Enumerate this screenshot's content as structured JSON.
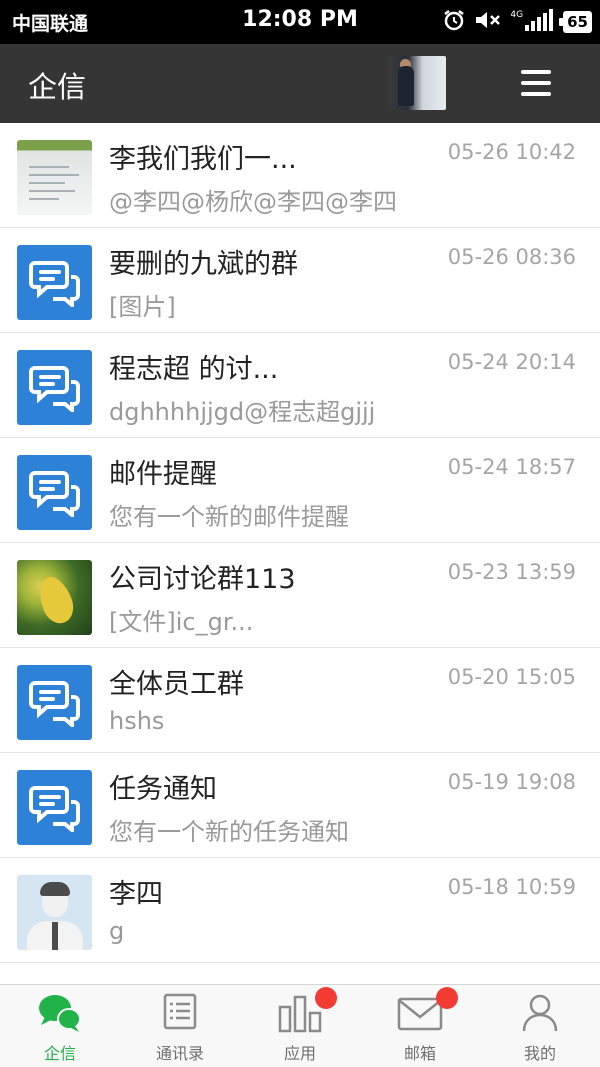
{
  "status_bar": {
    "carrier": "中国联通",
    "time": "12:08 PM",
    "network": "4G",
    "battery": "65"
  },
  "app_bar": {
    "title": "企信"
  },
  "chats": [
    {
      "title": "李我们我们一...",
      "preview": "@李四@杨欣@李四@李四",
      "time": "05-26 10:42",
      "avatar": "document-photo"
    },
    {
      "title": "要删的九斌的群",
      "preview": "[图片]",
      "time": "05-26 08:36",
      "avatar": "group-chat-icon"
    },
    {
      "title": "程志超 的讨...",
      "preview": "dghhhhjjgd@程志超gjjj",
      "time": "05-24 20:14",
      "avatar": "group-chat-icon"
    },
    {
      "title": "邮件提醒",
      "preview": "您有一个新的邮件提醒",
      "time": "05-24 18:57",
      "avatar": "group-chat-icon"
    },
    {
      "title": "公司讨论群113",
      "preview": "[文件]ic_gr...",
      "time": "05-23 13:59",
      "avatar": "leaf-photo"
    },
    {
      "title": "全体员工群",
      "preview": "hshs",
      "time": "05-20 15:05",
      "avatar": "group-chat-icon"
    },
    {
      "title": "任务通知",
      "preview": "您有一个新的任务通知",
      "time": "05-19 19:08",
      "avatar": "group-chat-icon"
    },
    {
      "title": "李四",
      "preview": "g",
      "time": "05-18 10:59",
      "avatar": "person-avatar"
    }
  ],
  "tabs": [
    {
      "label": "企信",
      "icon": "chat-bubbles-icon",
      "active": true
    },
    {
      "label": "通讯录",
      "icon": "contacts-list-icon",
      "active": false
    },
    {
      "label": "应用",
      "icon": "apps-bars-icon",
      "active": false,
      "badge": true
    },
    {
      "label": "邮箱",
      "icon": "mail-envelope-icon",
      "active": false,
      "badge": true
    },
    {
      "label": "我的",
      "icon": "profile-person-icon",
      "active": false
    }
  ],
  "colors": {
    "status_bar_bg": "#000000",
    "app_bar_bg": "#353535",
    "group_avatar": "#2d82d8",
    "tab_active": "#21b24a",
    "badge": "#f23b33"
  }
}
